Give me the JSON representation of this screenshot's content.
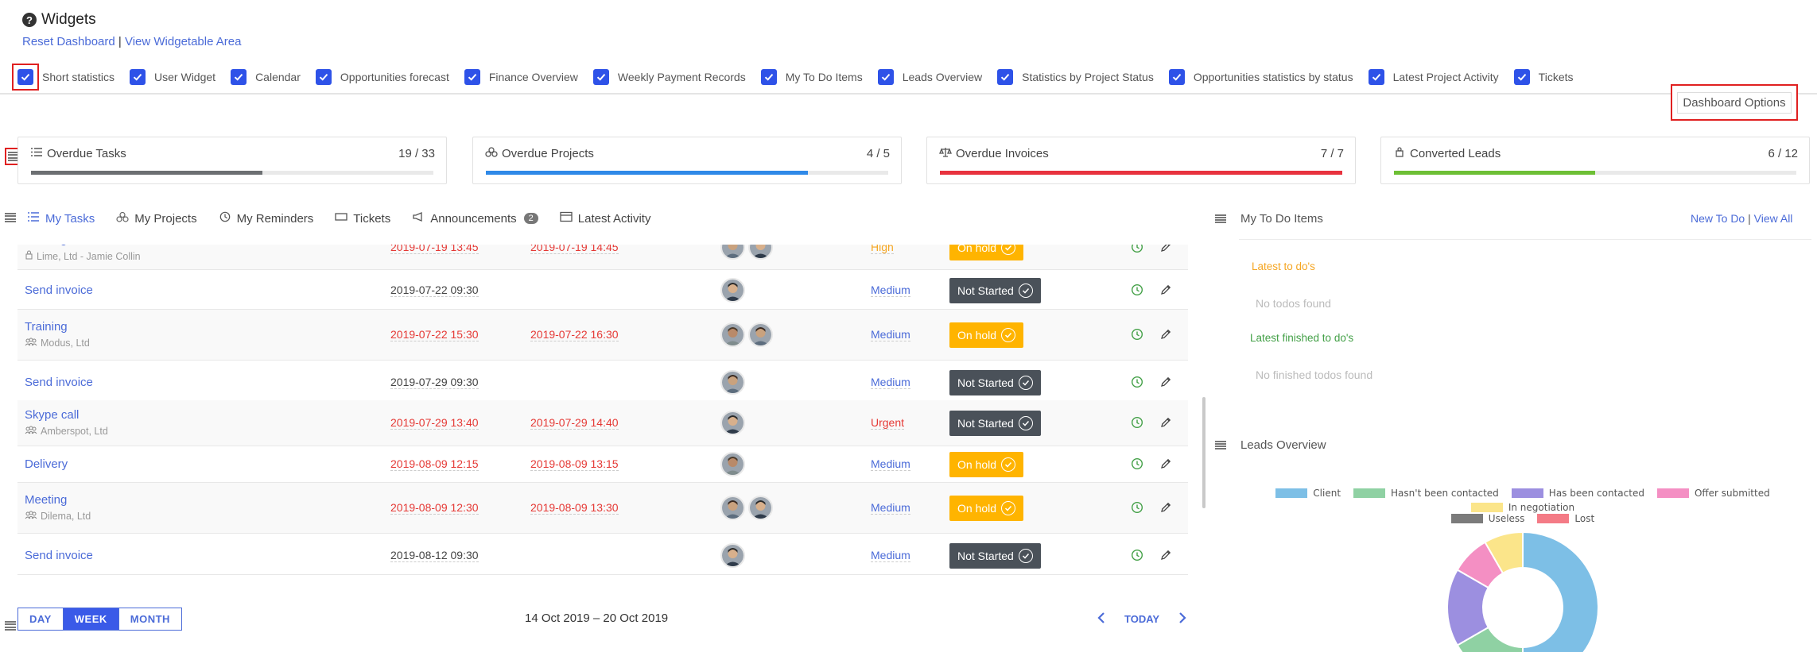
{
  "header": {
    "title": "Widgets",
    "reset_link": "Reset Dashboard",
    "separator": "|",
    "view_link": "View Widgetable Area"
  },
  "widgets": [
    {
      "label": "Short statistics",
      "checked": true
    },
    {
      "label": "User Widget",
      "checked": true
    },
    {
      "label": "Calendar",
      "checked": true
    },
    {
      "label": "Opportunities forecast",
      "checked": true
    },
    {
      "label": "Finance Overview",
      "checked": true
    },
    {
      "label": "Weekly Payment Records",
      "checked": true
    },
    {
      "label": "My To Do Items",
      "checked": true
    },
    {
      "label": "Leads Overview",
      "checked": true
    },
    {
      "label": "Statistics by Project Status",
      "checked": true
    },
    {
      "label": "Opportunities statistics by status",
      "checked": true
    },
    {
      "label": "Latest Project Activity",
      "checked": true
    },
    {
      "label": "Tickets",
      "checked": true
    }
  ],
  "dashboard_options": "Dashboard Options",
  "stats": [
    {
      "label": "Overdue Tasks",
      "count": "19 / 33",
      "fraction": 0.5758,
      "color": "#6c6f72"
    },
    {
      "label": "Overdue Projects",
      "count": "4 / 5",
      "fraction": 0.8,
      "color": "#2f89e8"
    },
    {
      "label": "Overdue Invoices",
      "count": "7 / 7",
      "fraction": 1.0,
      "color": "#e8323e"
    },
    {
      "label": "Converted Leads",
      "count": "6 / 12",
      "fraction": 0.5,
      "color": "#6dbf35"
    }
  ],
  "tabs": [
    {
      "label": "My Tasks",
      "active": true
    },
    {
      "label": "My Projects"
    },
    {
      "label": "My Reminders"
    },
    {
      "label": "Tickets"
    },
    {
      "label": "Announcements",
      "badge": "2"
    },
    {
      "label": "Latest Activity"
    }
  ],
  "tasks": [
    {
      "name": "Meeting",
      "related": "Lime, Ltd - Jamie Collin",
      "related_icon": "lead",
      "start": "2019-07-19 13:45",
      "due": "2019-07-19 14:45",
      "overdue": true,
      "assignees": 2,
      "priority": "High",
      "status": "On hold"
    },
    {
      "name": "Send invoice",
      "related": "",
      "start": "2019-07-22 09:30",
      "due": "",
      "overdue": false,
      "assignees": 1,
      "priority": "Medium",
      "status": "Not Started"
    },
    {
      "name": "Training",
      "related": "Modus, Ltd",
      "related_icon": "customer",
      "start": "2019-07-22 15:30",
      "due": "2019-07-22 16:30",
      "overdue": true,
      "assignees": 2,
      "priority": "Medium",
      "status": "On hold"
    },
    {
      "name": "Send invoice",
      "related": "",
      "start": "2019-07-29 09:30",
      "due": "",
      "overdue": false,
      "assignees": 1,
      "priority": "Medium",
      "status": "Not Started"
    },
    {
      "name": "Skype call",
      "related": "Amberspot, Ltd",
      "related_icon": "customer",
      "start": "2019-07-29 13:40",
      "due": "2019-07-29 14:40",
      "overdue": true,
      "assignees": 1,
      "priority": "Urgent",
      "status": "Not Started"
    },
    {
      "name": "Delivery",
      "related": "",
      "start": "2019-08-09 12:15",
      "due": "2019-08-09 13:15",
      "overdue": true,
      "assignees": 1,
      "priority": "Medium",
      "status": "On hold"
    },
    {
      "name": "Meeting",
      "related": "Dilema, Ltd",
      "related_icon": "customer",
      "start": "2019-08-09 12:30",
      "due": "2019-08-09 13:30",
      "overdue": true,
      "assignees": 2,
      "priority": "Medium",
      "status": "On hold"
    },
    {
      "name": "Send invoice",
      "related": "",
      "start": "2019-08-12 09:30",
      "due": "",
      "overdue": false,
      "assignees": 1,
      "priority": "Medium",
      "status": "Not Started"
    }
  ],
  "calendar": {
    "views": [
      "DAY",
      "WEEK",
      "MONTH"
    ],
    "active_view": "WEEK",
    "range": "14 Oct 2019 – 20 Oct 2019",
    "today": "TODAY"
  },
  "todo": {
    "title": "My To Do Items",
    "new_link": "New To Do",
    "separator": "|",
    "view_all": "View All",
    "latest_title": "Latest to do's",
    "no_todos": "No todos found",
    "finished_title": "Latest finished to do's",
    "no_finished": "No finished todos found"
  },
  "leads": {
    "title": "Leads Overview"
  },
  "chart_data": {
    "type": "pie",
    "donut": true,
    "title": "",
    "legend_position": "top",
    "categories": [
      "Client",
      "Hasn't been contacted",
      "Has been contacted",
      "Offer submitted",
      "In negotiation",
      "Useless",
      "Lost"
    ],
    "colors": [
      "#7dbfe6",
      "#8fd1a3",
      "#9c8fe0",
      "#f48fc3",
      "#fbe58a",
      "#7b7b7b",
      "#f47b86"
    ],
    "values": [
      6,
      2,
      2,
      1,
      1,
      0,
      0
    ]
  }
}
